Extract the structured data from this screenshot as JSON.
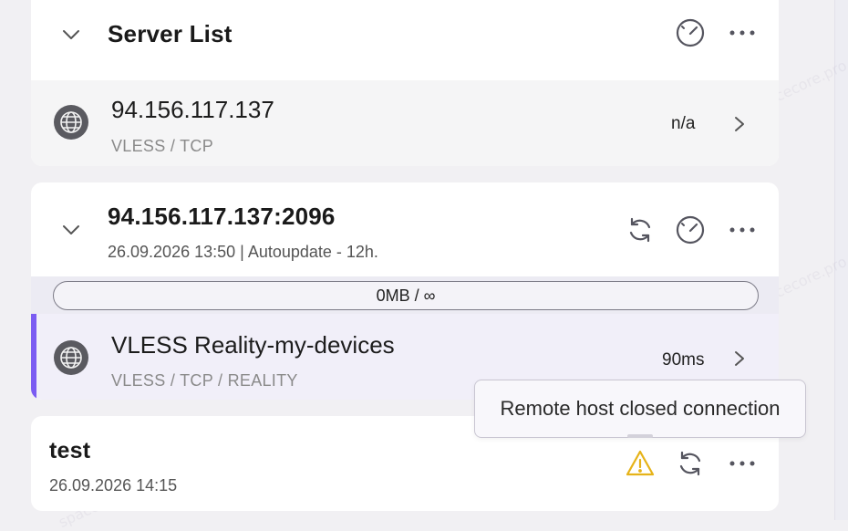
{
  "scrollbar": {},
  "groups": [
    {
      "title": "Server List",
      "subtitle": "",
      "servers": [
        {
          "name": "94.156.117.137",
          "protocol": "VLESS / TCP",
          "latency": "n/a",
          "selected": false
        }
      ]
    },
    {
      "title": "94.156.117.137:2096",
      "subtitle": "26.09.2026 13:50 | Autoupdate - 12h.",
      "usage": "0MB / ∞",
      "servers": [
        {
          "name": "VLESS Reality-my-devices",
          "protocol": "VLESS / TCP / REALITY",
          "latency": "90ms",
          "selected": true
        }
      ]
    },
    {
      "title": "test",
      "subtitle": "26.09.2026 14:15",
      "servers": []
    }
  ],
  "tooltip": {
    "text": "Remote host closed connection"
  },
  "watermark": "spacecore.pro",
  "colors": {
    "accent": "#7b5cf2",
    "warning": "#e6b319",
    "icon": "#55555f"
  },
  "icons": [
    "chevron-down-icon",
    "speedometer-icon",
    "more-icon",
    "globe-icon",
    "chevron-right-icon",
    "refresh-icon",
    "warning-icon"
  ]
}
